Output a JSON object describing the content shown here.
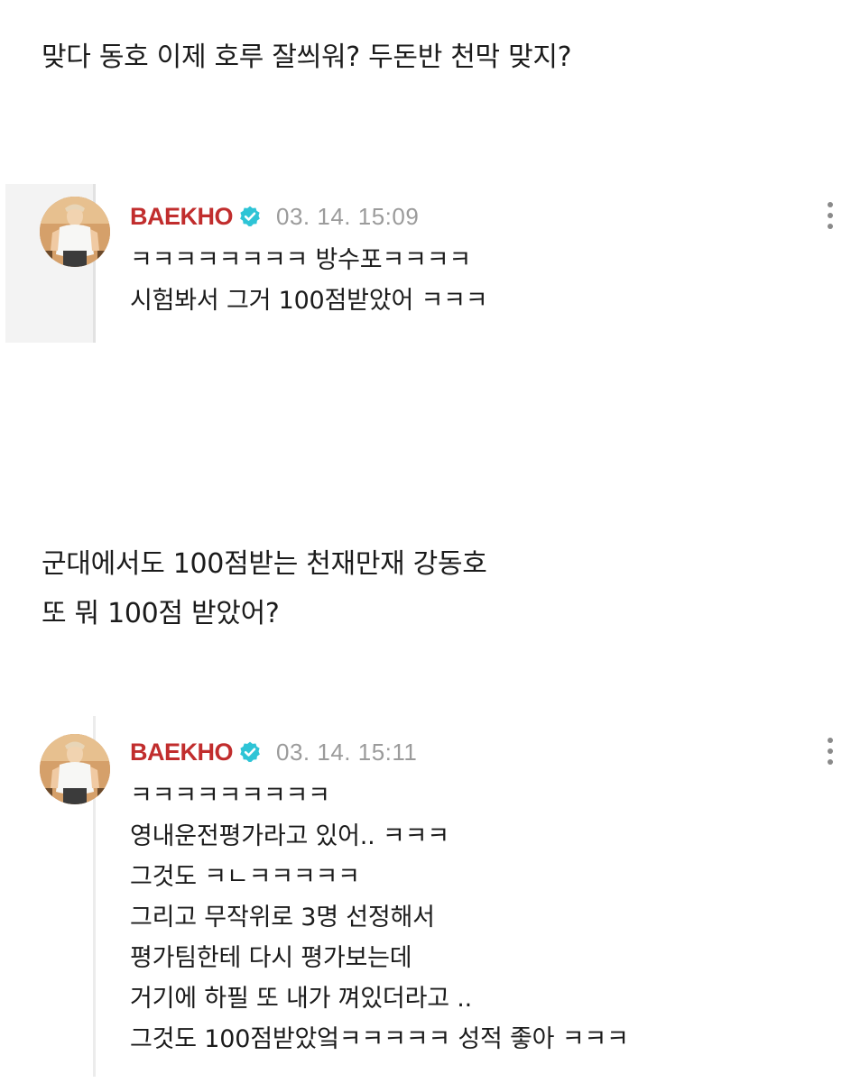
{
  "thread": {
    "question_1": [
      "맞다 동호 이제 호루 잘씌워? 두돈반 천막 맞지?"
    ],
    "reply_1": {
      "author": "BAEKHO",
      "timestamp": "03. 14. 15:09",
      "lines": [
        "ㅋㅋㅋㅋㅋㅋㅋㅋ 방수포ㅋㅋㅋㅋ",
        "시험봐서 그거 100점받았어 ㅋㅋㅋ"
      ]
    },
    "question_2": [
      "군대에서도 100점받는 천재만재 강동호",
      "또 뭐 100점 받았어?"
    ],
    "reply_2": {
      "author": "BAEKHO",
      "timestamp": "03. 14. 15:11",
      "lines": [
        "ㅋㅋㅋㅋㅋㅋㅋㅋㅋ",
        "영내운전평가라고 있어.. ㅋㅋㅋ",
        "그것도 ㅋㄴㅋㅋㅋㅋㅋ",
        "그리고 무작위로 3명 선정해서",
        "평가팀한테 다시 평가보는데",
        "거기에 하필 또 내가 껴있더라고 ..",
        "그것도 100점받았엌ㅋㅋㅋㅋㅋ 성적 좋아 ㅋㅋㅋ"
      ]
    }
  },
  "colors": {
    "author": "#c12d2d",
    "verified_badge": "#2ec4d6",
    "timestamp": "#9b9b9b",
    "text": "#1b1b1b",
    "reply_marker": "#e2e2e2"
  },
  "icons": {
    "verified": "verified-badge-icon",
    "more": "more-vertical-icon",
    "avatar": "avatar-photo"
  }
}
